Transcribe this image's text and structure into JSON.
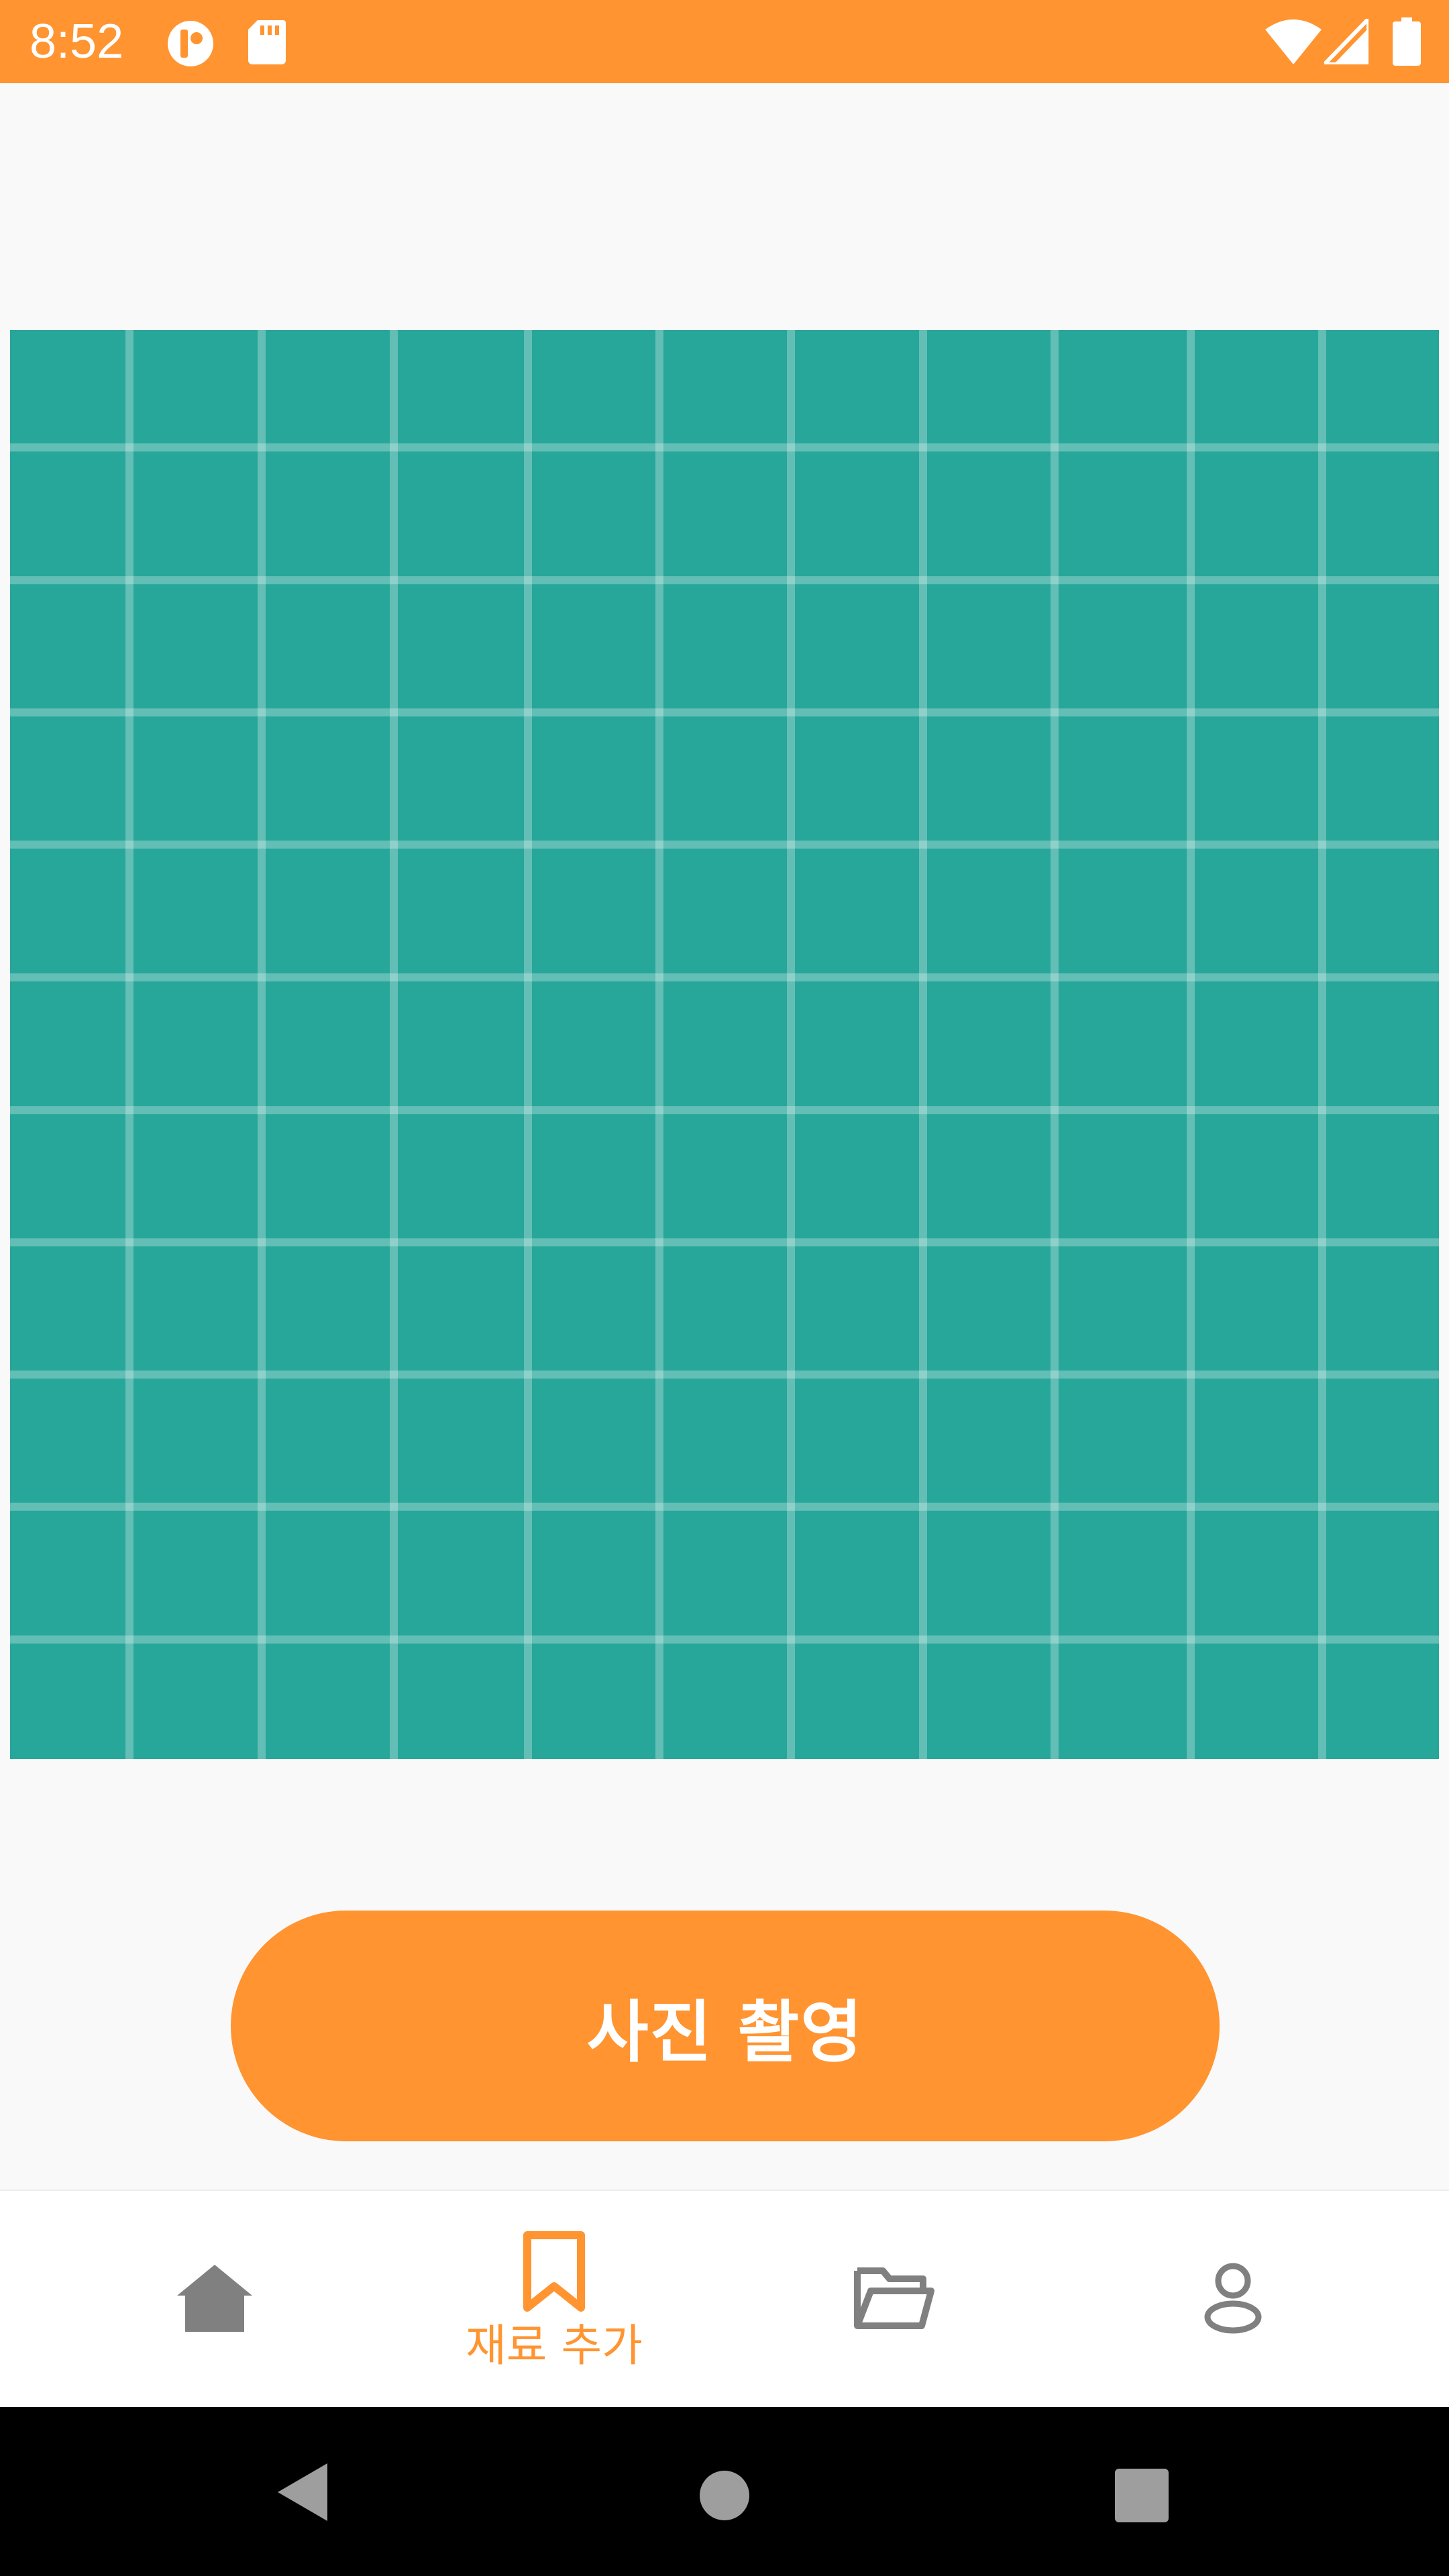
{
  "status_bar": {
    "time": "8:52",
    "background": "#ff9430",
    "icons": [
      "notification-app-icon",
      "sd-card-icon",
      "wifi-icon",
      "cellular-signal-icon",
      "battery-icon"
    ]
  },
  "camera_preview": {
    "background": "#27a69a",
    "overlay": "grid"
  },
  "capture_button": {
    "label": "사진 촬영",
    "color": "#ff9430"
  },
  "bottom_nav": {
    "active_color": "#ff9430",
    "inactive_color": "#808080",
    "items": [
      {
        "icon": "home-icon",
        "label": ""
      },
      {
        "icon": "bookmark-icon",
        "label": "재료 추가",
        "active": true
      },
      {
        "icon": "folder-icon",
        "label": ""
      },
      {
        "icon": "profile-icon",
        "label": ""
      }
    ]
  },
  "system_nav": {
    "buttons": [
      "back-icon",
      "home-circle-icon",
      "recents-icon"
    ]
  }
}
